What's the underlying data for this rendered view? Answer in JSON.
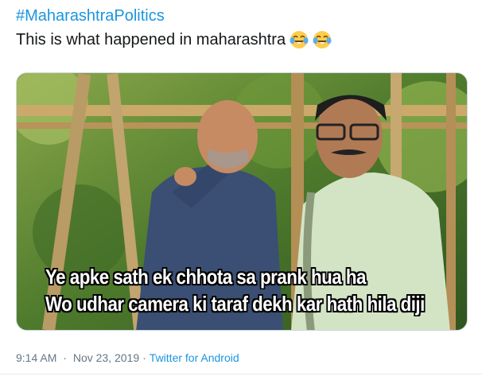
{
  "tweet": {
    "hashtag": "#MaharashtraPolitics",
    "text": "This is what happened in maharashtra",
    "emojis": [
      "face-with-tears-of-joy-icon",
      "face-with-tears-of-joy-icon"
    ],
    "media": {
      "caption_line_1": "Ye apke sath ek chhota sa prank hua ha",
      "caption_line_2": "Wo udhar camera ki taraf dekh kar hath hila diji"
    },
    "time": "9:14 AM",
    "separator": "·",
    "date": "Nov 23, 2019",
    "source": "Twitter for Android"
  },
  "colors": {
    "link": "#1b95e0",
    "text": "#14171a",
    "meta": "#657786"
  }
}
